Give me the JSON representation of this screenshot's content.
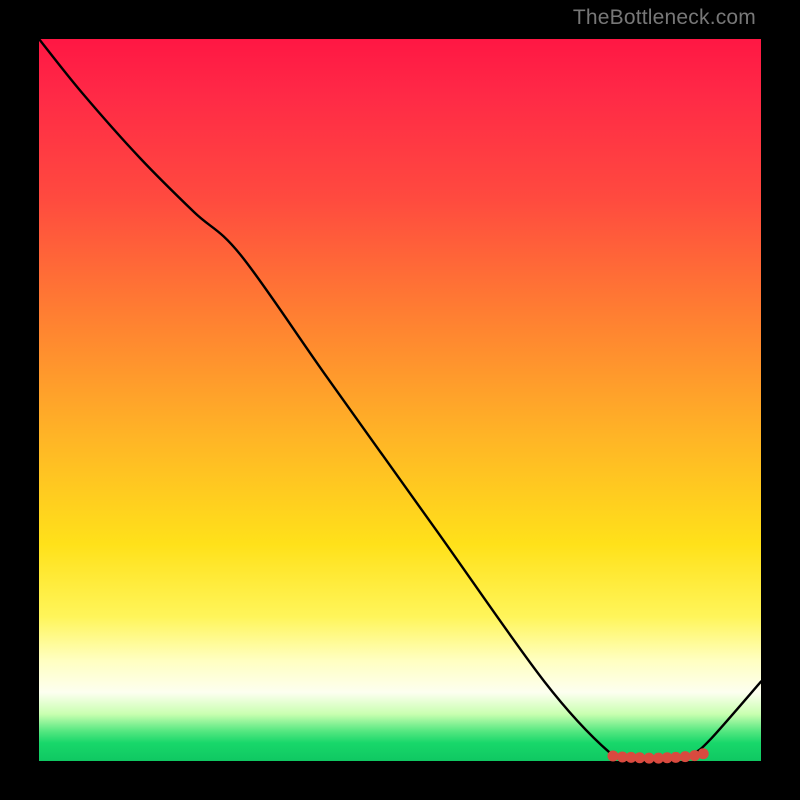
{
  "watermark": "TheBottleneck.com",
  "chart_data": {
    "type": "line",
    "title": "",
    "xlabel": "",
    "ylabel": "",
    "xlim": [
      0,
      100
    ],
    "ylim": [
      0,
      100
    ],
    "grid": false,
    "legend": false,
    "gradient_stops": [
      {
        "offset": 0.0,
        "color": "#ff1744"
      },
      {
        "offset": 0.08,
        "color": "#ff2a46"
      },
      {
        "offset": 0.22,
        "color": "#ff4a3f"
      },
      {
        "offset": 0.38,
        "color": "#ff7e32"
      },
      {
        "offset": 0.55,
        "color": "#ffb426"
      },
      {
        "offset": 0.7,
        "color": "#ffe11a"
      },
      {
        "offset": 0.8,
        "color": "#fff55a"
      },
      {
        "offset": 0.86,
        "color": "#ffffc0"
      },
      {
        "offset": 0.905,
        "color": "#fdfff0"
      },
      {
        "offset": 0.935,
        "color": "#c9ffb0"
      },
      {
        "offset": 0.958,
        "color": "#58e882"
      },
      {
        "offset": 0.975,
        "color": "#18d76a"
      },
      {
        "offset": 1.0,
        "color": "#0fc862"
      }
    ],
    "series": [
      {
        "name": "curve",
        "color": "#000000",
        "width": 2.4,
        "x": [
          0.0,
          6.0,
          14.0,
          21.5,
          28.0,
          40.0,
          55.0,
          70.0,
          79.0,
          82.0,
          84.0,
          86.0,
          88.0,
          90.5,
          93.0,
          100.0
        ],
        "y": [
          100.0,
          92.5,
          83.5,
          76.0,
          70.0,
          53.0,
          32.0,
          11.0,
          1.2,
          0.5,
          0.4,
          0.4,
          0.5,
          1.0,
          3.0,
          11.0
        ]
      }
    ],
    "markers": {
      "name": "flat-region-dots",
      "color": "#d94a3f",
      "radius": 5.5,
      "x": [
        79.5,
        80.8,
        82.0,
        83.2,
        84.5,
        85.8,
        87.0,
        88.2,
        89.5,
        90.8,
        92.0
      ],
      "y": [
        0.7,
        0.55,
        0.5,
        0.45,
        0.4,
        0.4,
        0.45,
        0.5,
        0.6,
        0.75,
        1.0
      ]
    }
  }
}
